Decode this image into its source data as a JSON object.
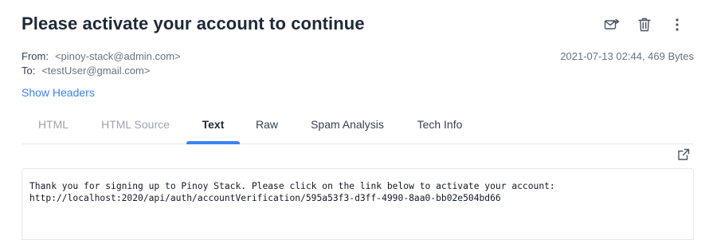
{
  "email": {
    "subject": "Please activate your account to continue",
    "from_label": "From:",
    "from_value": "<pinoy-stack@admin.com>",
    "to_label": "To:",
    "to_value": "<testUser@gmail.com>",
    "date_size": "2021-07-13 02:44, 469 Bytes",
    "show_headers": "Show Headers"
  },
  "actions": {
    "icons": [
      "forward-mail-icon",
      "trash-icon",
      "more-vertical-icon"
    ]
  },
  "tabs": [
    {
      "label": "HTML",
      "active": false
    },
    {
      "label": "HTML Source",
      "active": false
    },
    {
      "label": "Text",
      "active": true
    },
    {
      "label": "Raw",
      "active": false
    },
    {
      "label": "Spam Analysis",
      "active": false
    },
    {
      "label": "Tech Info",
      "active": false
    }
  ],
  "body": {
    "line1": "Thank you for signing up to Pinoy Stack. Please click on the link below to activate your account:",
    "line2": "http://localhost:2020/api/auth/accountVerification/595a53f3-d3ff-4990-8aa0-bb02e504bd66"
  },
  "colors": {
    "accent": "#3b82f6",
    "text": "#1f2937",
    "muted": "#6b7280"
  }
}
